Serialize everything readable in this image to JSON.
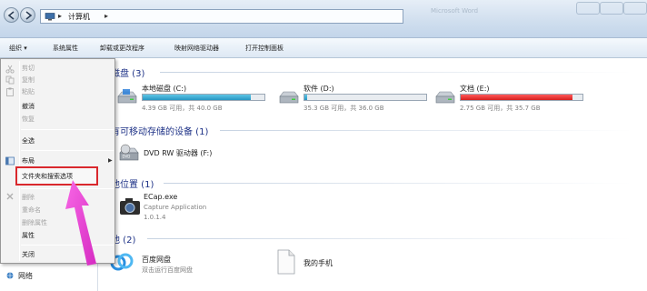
{
  "window": {
    "breadcrumb": "计算机",
    "faded_title": "Microsoft Word"
  },
  "toolbar": {
    "organize": "组织 ▾",
    "system_properties": "系统属性",
    "uninstall": "卸载或更改程序",
    "map_drive": "映射网络驱动器",
    "control_panel": "打开控制面板"
  },
  "menu": {
    "items": [
      {
        "label": "剪切",
        "enabled": false,
        "icon": "scissors-icon"
      },
      {
        "label": "复制",
        "enabled": false,
        "icon": "copy-icon"
      },
      {
        "label": "粘贴",
        "enabled": false,
        "icon": "paste-icon"
      },
      {
        "label": "撤消",
        "enabled": true
      },
      {
        "label": "恢复",
        "enabled": false
      },
      {
        "label": "全选",
        "enabled": true
      },
      {
        "label": "布局",
        "enabled": true,
        "icon": "layout-icon",
        "has_submenu": true
      },
      {
        "label": "文件夹和搜索选项",
        "enabled": true,
        "highlighted": true
      },
      {
        "label": "删除",
        "enabled": false,
        "icon": "delete-x-icon"
      },
      {
        "label": "重命名",
        "enabled": false
      },
      {
        "label": "删除属性",
        "enabled": false
      },
      {
        "label": "属性",
        "enabled": true
      },
      {
        "label": "关闭",
        "enabled": true
      }
    ],
    "highlight_color": "#d9282d"
  },
  "navpane": {
    "network": "网络"
  },
  "groups": {
    "hard_disks": "磁盘 (3)",
    "removable": "有可移动存储的设备 (1)",
    "other_location": "他位置 (1)",
    "other": "他 (2)"
  },
  "drives": [
    {
      "name": "本地磁盘 (C:)",
      "info": "4.39 GB 可用，共 40.0 GB",
      "used_fraction": 0.89,
      "color": "blue"
    },
    {
      "name": "软件 (D:)",
      "info": "35.3 GB 可用，共 36.0 GB",
      "used_fraction": 0.02,
      "color": "blue"
    },
    {
      "name": "文档 (E:)",
      "info": "2.75 GB 可用，共 35.7 GB",
      "used_fraction": 0.92,
      "color": "red"
    }
  ],
  "removable": {
    "dvd": "DVD RW 驱动器 (F:)"
  },
  "other_location": {
    "name": "ECap.exe",
    "desc": "Capture Application",
    "version": "1.0.1.4"
  },
  "other": {
    "baidu_name": "百度网盘",
    "baidu_desc": "双击运行百度网盘",
    "phone_name": "我的手机"
  },
  "colors": {
    "group_title": "#1e3287",
    "annotation_arrow": "#ee44d6"
  }
}
